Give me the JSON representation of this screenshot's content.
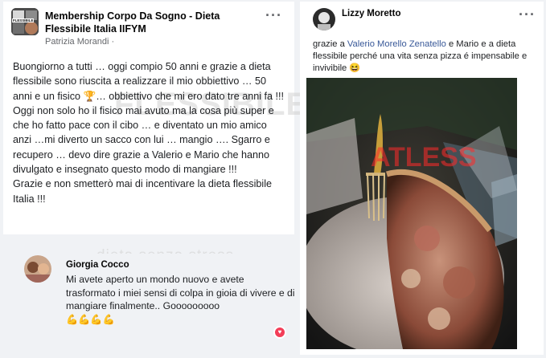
{
  "left_post": {
    "group_title": "Membership Corpo Da Sogno - Dieta Flessibile Italia IIFYM",
    "author": "Patrizia Morandi",
    "author_suffix": "·",
    "more_icon": "more-horizontal-icon",
    "avatar_text": "FLESSIBILE",
    "body": "Buongiorno a tutti … oggi compio 50 anni e grazie a dieta flessibile sono riuscita a realizzare il mio obbiettivo … 50 anni e un fisico 🏆… obbiettivo che mi ero dato tre anni fa !!!\nOggi non solo ho il fisico mai avuto ma la cosa più super e che ho fatto pace con il cibo … e diventato un mio amico anzi …mi diverto un sacco con lui … mangio …. Sgarro  e recupero  … devo dire grazie a Valerio e Mario che hanno divulgato e insegnato questo modo di mangiare !!!\nGrazie e non smetterò mai di incentivare la dieta flessibile Italia !!!"
  },
  "comment": {
    "author": "Giorgia Cocco",
    "text": "Mi avete aperto un mondo nuovo e avete trasformato i miei sensi di colpa in gioia di vivere e di mangiare finalmente.. Gooooooooo",
    "emoji": "💪💪💪💪",
    "reaction_icon": "love-reaction-icon"
  },
  "right_post": {
    "author": "Lizzy Moretto",
    "text_before": "grazie a ",
    "mention": "Valerio Morello Zenatello",
    "text_after": "  e Mario e a dieta flessibile perché una vita senza pizza é impensabile e invivibile 😆",
    "more_icon": "more-horizontal-icon",
    "photo": "pizza-photo"
  },
  "watermarks": {
    "main": "FLESSIBILE",
    "sub": "dieta senza stress",
    "right": "ATLESS"
  },
  "colors": {
    "background": "#f0f2f5",
    "card": "#ffffff",
    "link": "#385898",
    "secondary_text": "#65676b",
    "watermark": "#e8585a"
  }
}
